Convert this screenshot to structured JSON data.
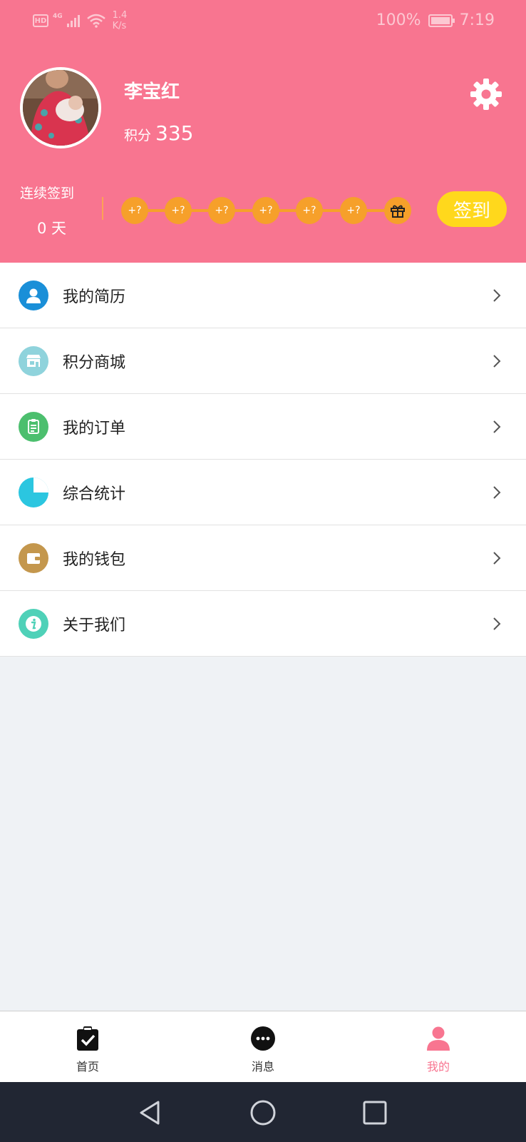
{
  "status_bar": {
    "network_hd": "HD",
    "network_type": "4G",
    "speed_value": "1.4",
    "speed_unit": "K/s",
    "battery": "100%",
    "time": "7:19"
  },
  "profile": {
    "name": "李宝红",
    "points_label": "积分",
    "points_value": "335"
  },
  "checkin": {
    "streak_label": "连续签到",
    "streak_days": "0 天",
    "steps": [
      "+?",
      "+?",
      "+?",
      "+?",
      "+?",
      "+?"
    ],
    "button_label": "签到"
  },
  "menu": {
    "items": [
      {
        "label": "我的简历",
        "icon": "person-icon",
        "color": "#1a8fd8"
      },
      {
        "label": "积分商城",
        "icon": "shop-icon",
        "color": "#8fd3dc"
      },
      {
        "label": "我的订单",
        "icon": "clipboard-icon",
        "color": "#4cbf6e"
      },
      {
        "label": "综合统计",
        "icon": "pie-chart-icon",
        "color": "#2bc6e0"
      },
      {
        "label": "我的钱包",
        "icon": "wallet-icon",
        "color": "#c4974d"
      },
      {
        "label": "关于我们",
        "icon": "info-icon",
        "color": "#4fd1b8"
      }
    ]
  },
  "bottom_nav": {
    "tabs": [
      {
        "label": "首页",
        "icon": "clipboard-check-icon"
      },
      {
        "label": "消息",
        "icon": "message-icon"
      },
      {
        "label": "我的",
        "icon": "person-icon",
        "active": true
      }
    ]
  },
  "colors": {
    "header_bg": "#f87590",
    "step_orange": "#f6a02a",
    "checkin_yellow": "#ffd81c",
    "active_tab": "#f87590"
  }
}
